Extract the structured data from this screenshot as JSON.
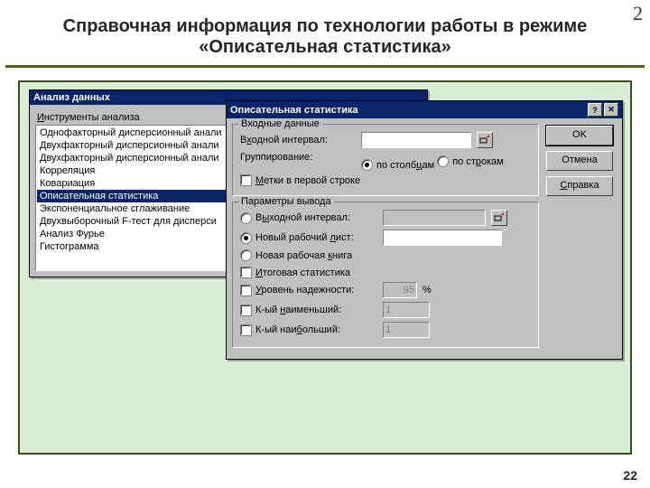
{
  "corner_number": "2",
  "page_number": "22",
  "title": "Справочная информация по технологии работы в режиме «Описательная статистика»",
  "dlg1": {
    "title": "Анализ данных",
    "tools_label": "Инструменты анализа",
    "items": [
      "Однофакторный дисперсионный анали",
      "Двухфакторный дисперсионный анали",
      "Двухфакторный дисперсионный анали",
      "Корреляция",
      "Ковариация",
      "Описательная статистика",
      "Экспоненциальное сглаживание",
      "Двухвыборочный F-тест для дисперси",
      "Анализ Фурье",
      "Гистограмма"
    ],
    "selected_index": 5
  },
  "dlg2": {
    "title": "Описательная статистика",
    "group_input": "Входные данные",
    "lbl_input_range": "Входной интервал:",
    "lbl_grouping": "Группирование:",
    "opt_by_cols": "по столбцам",
    "opt_by_rows": "по строкам",
    "chk_labels": "Метки в первой строке",
    "group_output": "Параметры вывода",
    "opt_out_range": "Выходной интервал:",
    "opt_new_sheet": "Новый рабочий лист:",
    "opt_new_book": "Новая рабочая книга",
    "chk_summary": "Итоговая статистика",
    "chk_conf": "Уровень надежности:",
    "conf_val": "95",
    "pct": "%",
    "chk_kmin": "К-ый наименьший:",
    "kmin_val": "1",
    "chk_kmax": "К-ый наибольший:",
    "kmax_val": "1",
    "btn_ok": "OK",
    "btn_cancel": "Отмена",
    "btn_help": "Справка",
    "help_u": "С"
  }
}
